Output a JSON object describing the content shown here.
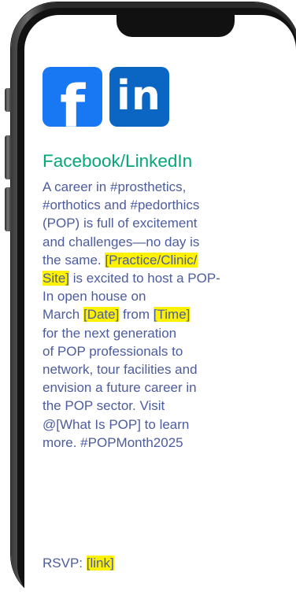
{
  "icons": {
    "facebook_glyph": "f",
    "linkedin_glyph": "in",
    "facebook_color": "#1877f2",
    "linkedin_color": "#0a66c2"
  },
  "post": {
    "heading": "Facebook/LinkedIn",
    "heading_color": "#05a67a",
    "text_color": "#4d5c9e",
    "highlight_color": "#fef200",
    "lines": {
      "l1": "A career in #prosthetics,",
      "l2": "#orthotics and #pedorthics",
      "l3": "(POP) is full of excitement",
      "l4": "and challenges—no day is",
      "l5a": "the same. ",
      "l5b": "[Practice/Clinic/",
      "l6a": "Site]",
      "l6b": " is excited to host a POP-",
      "l7": "In open house on",
      "l8a": "March ",
      "l8b": "[Date]",
      "l8c": " from ",
      "l8d": "[Time]",
      "l9": "for the next generation",
      "l10": "of POP professionals to",
      "l11": "network, tour facilities and",
      "l12": "envision a future career in",
      "l13": "the POP sector. Visit",
      "l14": "@[What Is POP] to learn",
      "l15": "more. #POPMonth2025"
    },
    "rsvp_label": "RSVP: ",
    "rsvp_link": "[link]"
  }
}
